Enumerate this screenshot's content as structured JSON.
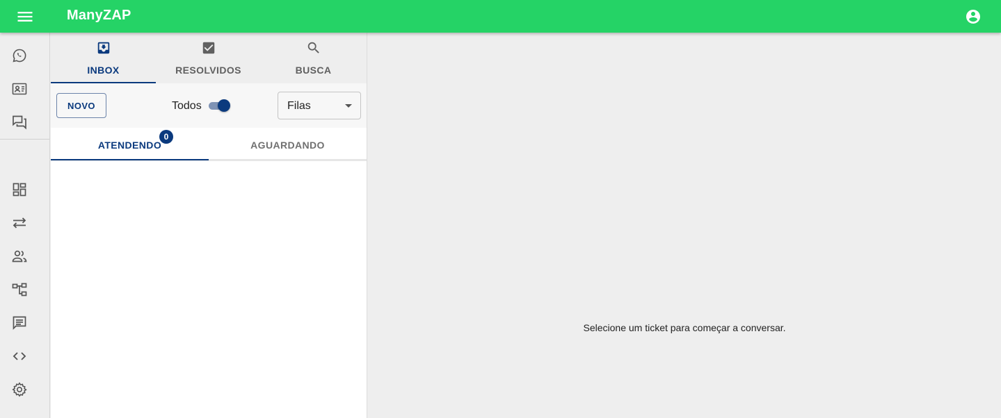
{
  "app": {
    "title": "ManyZAP"
  },
  "appbar": {
    "menu_icon": "menu-icon",
    "account_icon": "account-circle-icon"
  },
  "sidebar": {
    "top_items": [
      {
        "icon": "whatsapp-icon",
        "name": "connections"
      },
      {
        "icon": "contact-card-icon",
        "name": "contacts"
      },
      {
        "icon": "forum-icon",
        "name": "tickets"
      }
    ],
    "bottom_items": [
      {
        "icon": "dashboard-icon",
        "name": "dashboard"
      },
      {
        "icon": "swap-horiz-icon",
        "name": "transfers"
      },
      {
        "icon": "people-icon",
        "name": "users"
      },
      {
        "icon": "account-tree-icon",
        "name": "queues"
      },
      {
        "icon": "chat-message-icon",
        "name": "quick-answers"
      },
      {
        "icon": "code-icon",
        "name": "api"
      },
      {
        "icon": "settings-icon",
        "name": "settings"
      }
    ]
  },
  "ticket_tabs": [
    {
      "label": "INBOX",
      "icon": "inbox-icon",
      "active": true
    },
    {
      "label": "RESOLVIDOS",
      "icon": "checkbox-icon",
      "active": false
    },
    {
      "label": "BUSCA",
      "icon": "search-icon",
      "active": false
    }
  ],
  "actions": {
    "new_button": "NOVO",
    "show_all_label": "Todos",
    "show_all_on": true,
    "queue_select": {
      "value": "Filas"
    }
  },
  "status_tabs": [
    {
      "label": "ATENDENDO",
      "badge": "0",
      "active": true
    },
    {
      "label": "AGUARDANDO",
      "active": false
    }
  ],
  "main": {
    "placeholder": "Selecione um ticket para começar a conversar."
  },
  "colors": {
    "appbar": "#25d366",
    "primary": "#0b3a7e",
    "background": "#eeeeee"
  }
}
